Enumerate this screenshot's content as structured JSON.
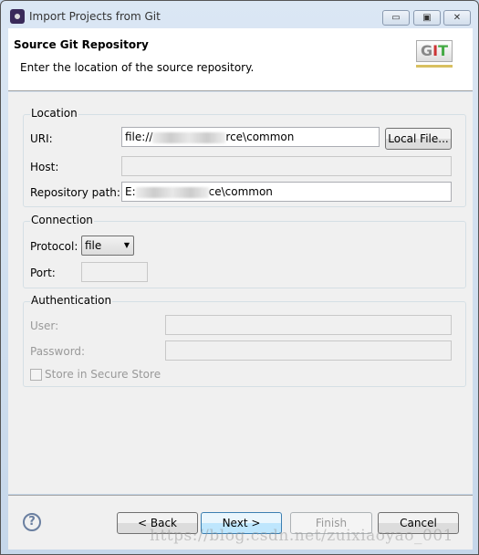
{
  "window": {
    "title": "Import Projects from Git",
    "minimize_icon": "minimize-icon",
    "maximize_icon": "maximize-icon",
    "close_icon": "close-icon"
  },
  "header": {
    "title": "Source Git Repository",
    "description": "Enter the location of the source repository.",
    "icon": "git-icon",
    "icon_text": {
      "g": "G",
      "i": "I",
      "t": "T"
    }
  },
  "location": {
    "label": "Location",
    "uri_label": "URI:",
    "uri_prefix": "file://",
    "uri_suffix": "rce\\common",
    "local_file_button": "Local File...",
    "host_label": "Host:",
    "host_value": "",
    "repo_path_label": "Repository path:",
    "repo_path_prefix": "E:",
    "repo_path_suffix": "ce\\common"
  },
  "connection": {
    "label": "Connection",
    "protocol_label": "Protocol:",
    "protocol_value": "file",
    "port_label": "Port:",
    "port_value": ""
  },
  "authentication": {
    "label": "Authentication",
    "user_label": "User:",
    "password_label": "Password:",
    "store_label": "Store in Secure Store",
    "store_checked": false
  },
  "footer": {
    "help_icon": "help-icon",
    "back": "< Back",
    "next": "Next >",
    "finish": "Finish",
    "cancel": "Cancel",
    "watermark": "https://blog.csdn.net/zuixiaoyao_001"
  }
}
